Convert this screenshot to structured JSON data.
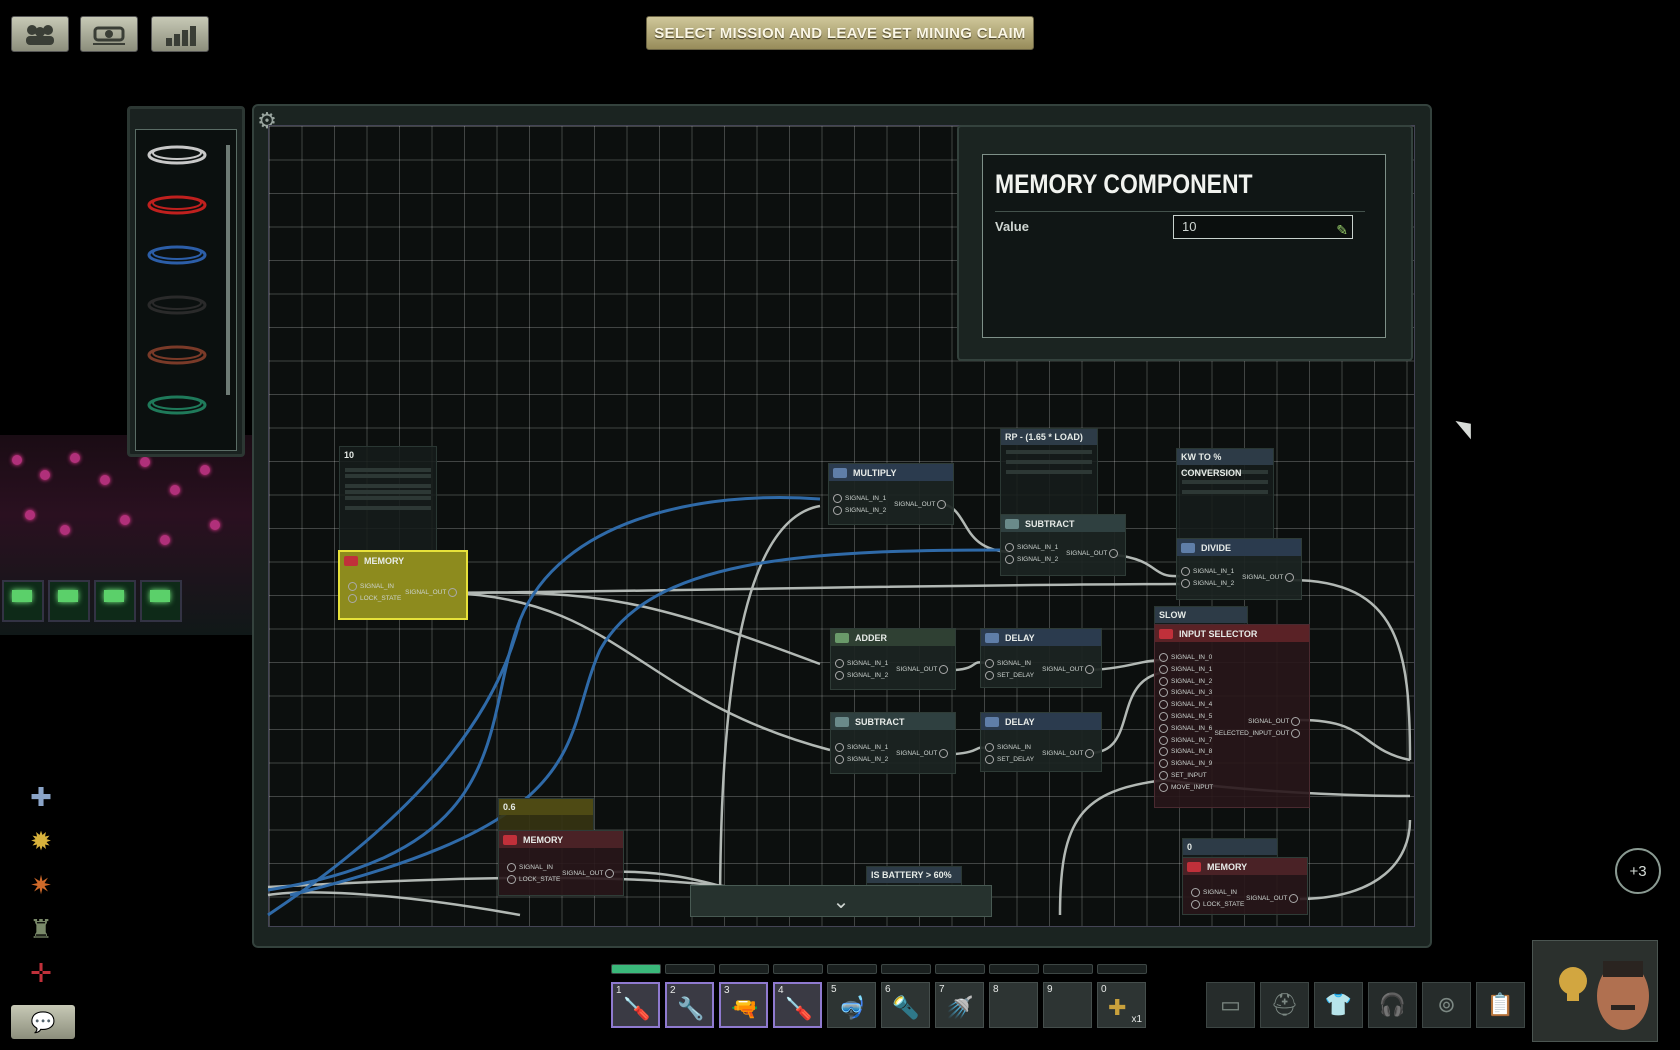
{
  "top_buttons": [
    {
      "icon": "crew-icon"
    },
    {
      "icon": "submarine-icon"
    },
    {
      "icon": "statistics-icon"
    }
  ],
  "mission_button": {
    "label": "SELECT MISSION AND LEAVE SET MINING CLAIM"
  },
  "wire_palette": {
    "wires": [
      {
        "color": "#c8c8c8"
      },
      {
        "color": "#c0201e"
      },
      {
        "color": "#2c5ea8"
      },
      {
        "color": "#2a2a2a"
      },
      {
        "color": "#7a3a28"
      },
      {
        "color": "#1f7a5a"
      }
    ]
  },
  "component_panel": {
    "title": "MEMORY COMPONENT",
    "value_label": "Value",
    "value": "10"
  },
  "nodes": {
    "label_10": {
      "title": "10"
    },
    "memory_main": {
      "title": "MEMORY",
      "in1": "SIGNAL_IN",
      "in2": "LOCK_STATE",
      "out": "SIGNAL_OUT"
    },
    "multiply": {
      "title": "MULTIPLY",
      "in1": "SIGNAL_IN_1",
      "in2": "SIGNAL_IN_2",
      "out": "SIGNAL_OUT"
    },
    "rp_label": {
      "title": "RP - (1.65 * LOAD)"
    },
    "subtract1": {
      "title": "SUBTRACT",
      "in1": "SIGNAL_IN_1",
      "in2": "SIGNAL_IN_2",
      "out": "SIGNAL_OUT"
    },
    "kw_label": {
      "title": "KW TO % CONVERSION"
    },
    "divide": {
      "title": "DIVIDE",
      "in1": "SIGNAL_IN_1",
      "in2": "SIGNAL_IN_2",
      "out": "SIGNAL_OUT"
    },
    "adder": {
      "title": "ADDER",
      "in1": "SIGNAL_IN_1",
      "in2": "SIGNAL_IN_2",
      "out": "SIGNAL_OUT"
    },
    "delay1": {
      "title": "DELAY",
      "in1": "SIGNAL_IN",
      "in2": "SET_DELAY",
      "out": "SIGNAL_OUT"
    },
    "slow_label": {
      "title": "SLOW IN-/DECREASE"
    },
    "input_selector": {
      "title": "INPUT SELECTOR",
      "inputs": [
        "SIGNAL_IN_0",
        "SIGNAL_IN_1",
        "SIGNAL_IN_2",
        "SIGNAL_IN_3",
        "SIGNAL_IN_4",
        "SIGNAL_IN_5",
        "SIGNAL_IN_6",
        "SIGNAL_IN_7",
        "SIGNAL_IN_8",
        "SIGNAL_IN_9",
        "SET_INPUT",
        "MOVE_INPUT"
      ],
      "out1": "SIGNAL_OUT",
      "out2": "SELECTED_INPUT_OUT"
    },
    "subtract2": {
      "title": "SUBTRACT",
      "in1": "SIGNAL_IN_1",
      "in2": "SIGNAL_IN_2",
      "out": "SIGNAL_OUT"
    },
    "delay2": {
      "title": "DELAY",
      "in1": "SIGNAL_IN",
      "in2": "SET_DELAY",
      "out": "SIGNAL_OUT"
    },
    "label_06": {
      "title": "0.6"
    },
    "memory2": {
      "title": "MEMORY",
      "in1": "SIGNAL_IN",
      "in2": "LOCK_STATE",
      "out": "SIGNAL_OUT"
    },
    "battery_label": {
      "title": "IS BATTERY > 60%"
    },
    "label_0": {
      "title": "0"
    },
    "memory3": {
      "title": "MEMORY",
      "in1": "SIGNAL_IN",
      "in2": "LOCK_STATE",
      "out": "SIGNAL_OUT"
    }
  },
  "skills": [
    {
      "icon": "medical-skill-icon",
      "color": "#8aa4c8"
    },
    {
      "icon": "electrical-skill-icon",
      "color": "#d8b23c"
    },
    {
      "icon": "weapons-skill-icon",
      "color": "#d06a2a"
    },
    {
      "icon": "mechanical-skill-icon",
      "color": "#7a8a6a"
    },
    {
      "icon": "helm-skill-icon",
      "color": "#c0303a"
    }
  ],
  "extra_badge": "+3",
  "hotbar": [
    {
      "num": "1",
      "icon": "screwdriver-icon",
      "selected": true,
      "count": ""
    },
    {
      "num": "2",
      "icon": "wrench-icon",
      "selected": true,
      "count": ""
    },
    {
      "num": "3",
      "icon": "welding-tool-icon",
      "selected": true,
      "count": ""
    },
    {
      "num": "4",
      "icon": "screwdriver-icon",
      "selected": true,
      "count": ""
    },
    {
      "num": "5",
      "icon": "diving-mask-icon",
      "selected": false,
      "count": ""
    },
    {
      "num": "6",
      "icon": "flashlight-icon",
      "selected": false,
      "count": ""
    },
    {
      "num": "7",
      "icon": "watering-can-icon",
      "selected": false,
      "count": ""
    },
    {
      "num": "8",
      "icon": "",
      "selected": false,
      "count": ""
    },
    {
      "num": "9",
      "icon": "",
      "selected": false,
      "count": ""
    },
    {
      "num": "0",
      "icon": "medkit-icon",
      "selected": false,
      "count": "x1"
    }
  ],
  "equipment": [
    {
      "icon": "id-card-icon"
    },
    {
      "icon": "helmet-icon"
    },
    {
      "icon": "jacket-icon"
    },
    {
      "icon": "headset-icon"
    },
    {
      "icon": "goggles-icon"
    },
    {
      "icon": "clipboard-icon"
    }
  ]
}
